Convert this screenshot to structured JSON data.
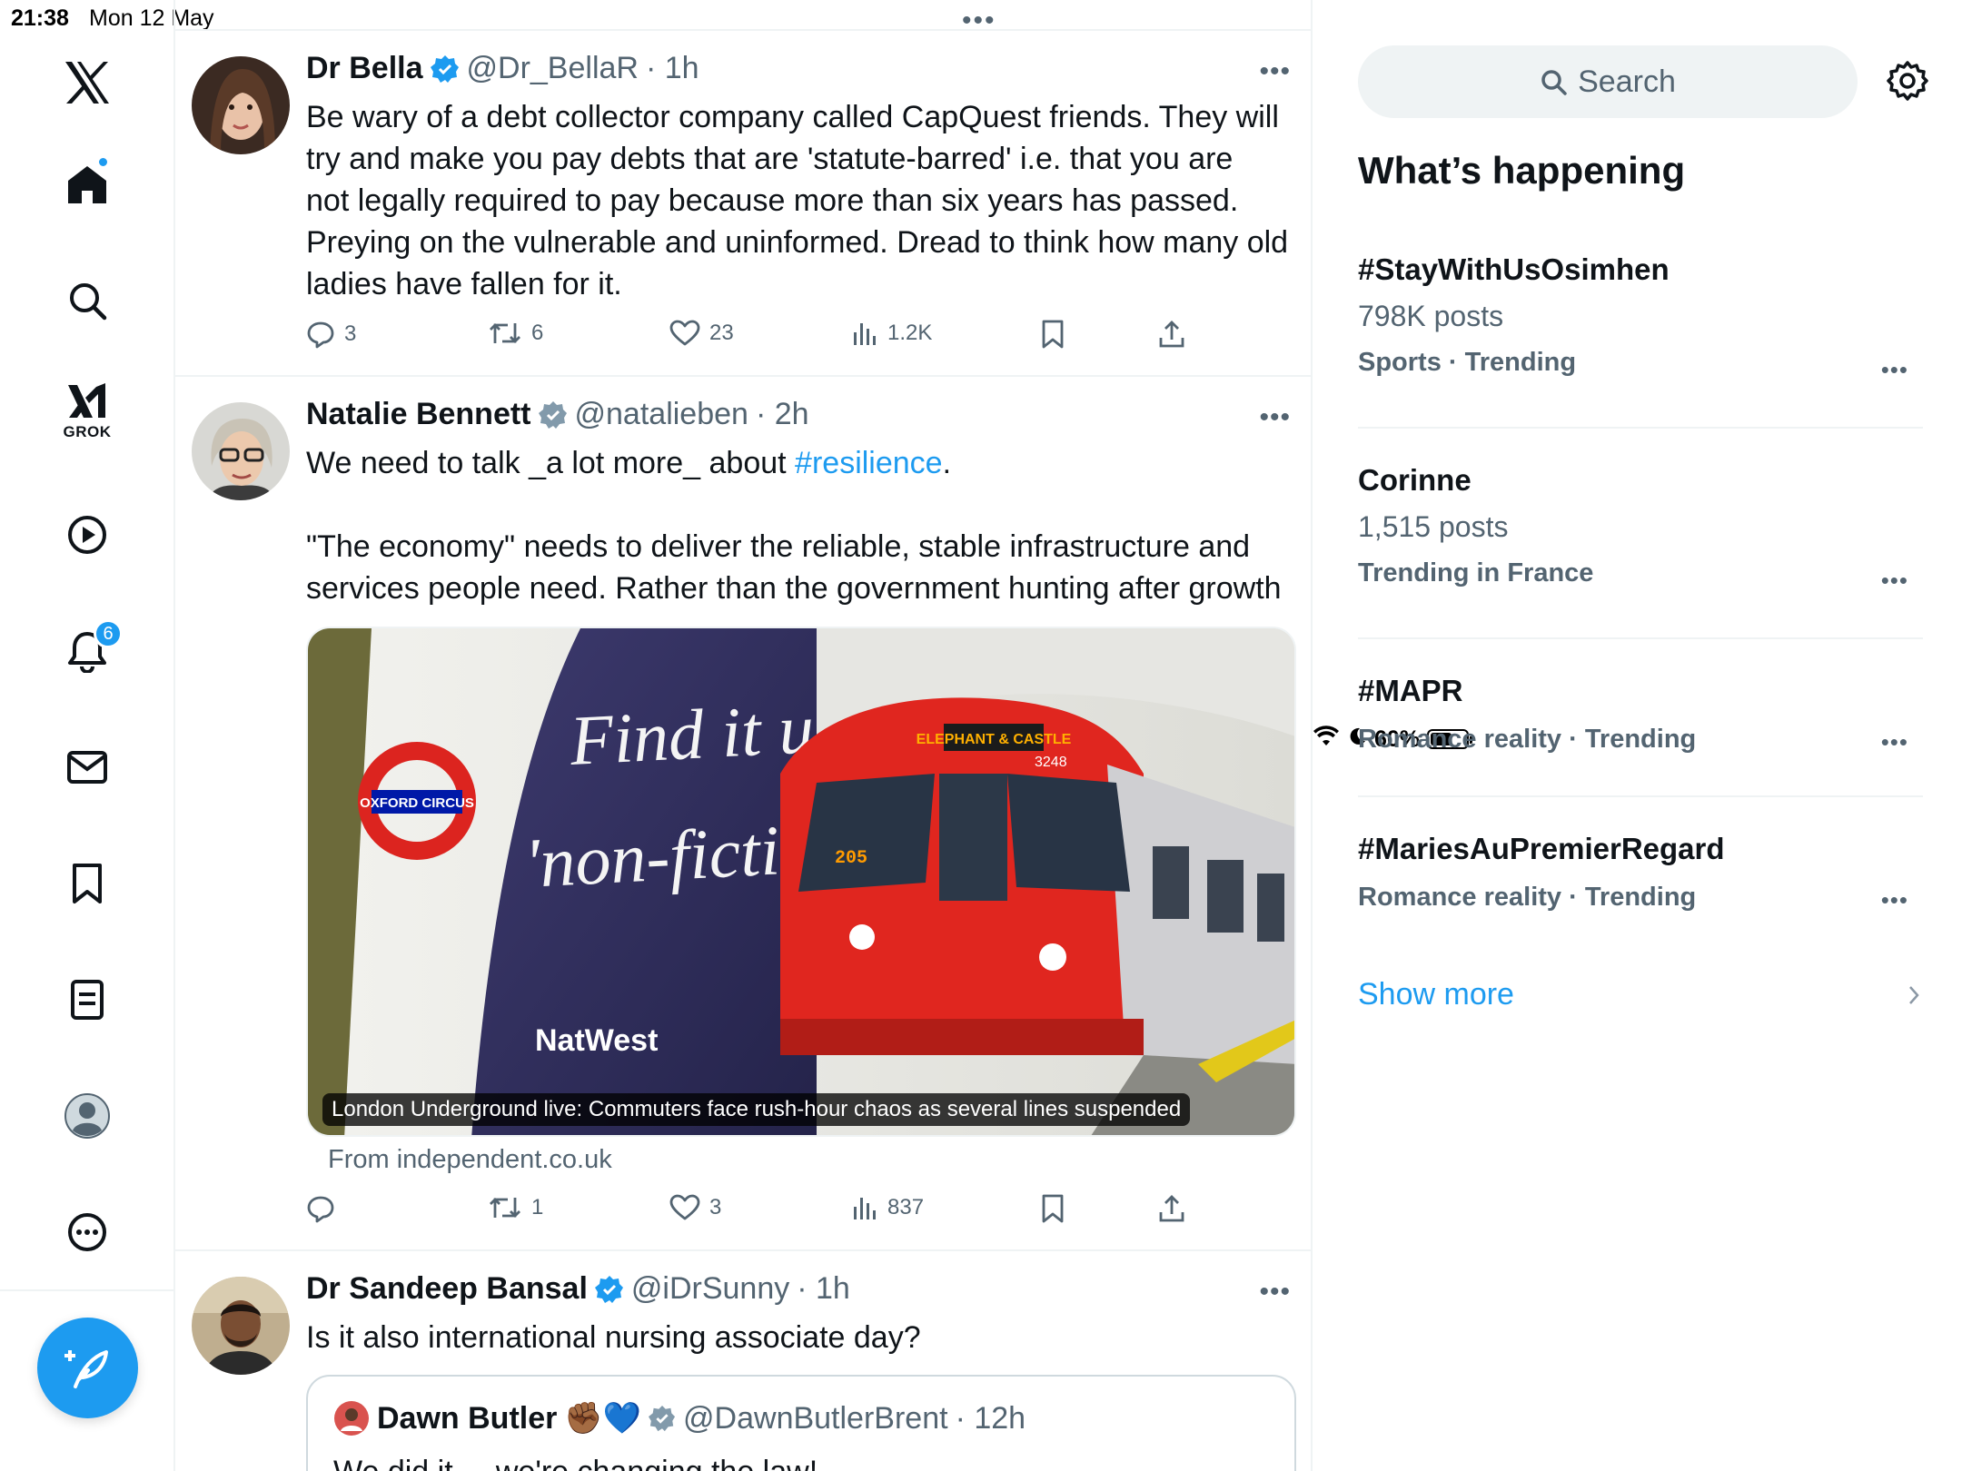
{
  "status_bar": {
    "time": "21:38",
    "date": "Mon 12 May",
    "battery": "60%",
    "battery_level": 0.6
  },
  "nav": {
    "grok_label": "GROK",
    "notifications_badge": "6"
  },
  "tweets": [
    {
      "name": "Dr Bella",
      "handle": "@Dr_BellaR",
      "time": "· 1h",
      "lines": [
        "Be wary of a debt collector company called CapQuest friends. They will",
        "try and make you pay debts that are 'statute-barred' i.e. that you are",
        "not legally required to pay because more than six years has passed.",
        "Preying on the vulnerable and uninformed. Dread to think how many old",
        "ladies have fallen for it."
      ],
      "replies": "3",
      "reposts": "6",
      "likes": "23",
      "views": "1.2K"
    },
    {
      "name": "Natalie Bennett",
      "handle": "@natalieben",
      "time": "· 2h",
      "line1_prefix": "We need to talk _a lot more_ about ",
      "line1_hashtag": "#resilience",
      "line1_suffix": ".",
      "line3": "\"The economy\" needs to deliver the reliable, stable infrastructure and",
      "line4": "services people need. Rather than the government hunting after growth",
      "media": {
        "caption": "London Underground live: Commuters face rush-hour chaos as several lines suspended",
        "source": "From independent.co.uk",
        "billboard_line1": "Find it under",
        "billboard_line2": "'non-fiction'",
        "brand": "NatWest",
        "roundel": "OXFORD CIRCUS",
        "destination": "ELEPHANT & CASTLE",
        "train_number": "3248",
        "route_number": "205"
      },
      "replies": "",
      "reposts": "1",
      "likes": "3",
      "views": "837"
    },
    {
      "name": "Dr Sandeep Bansal",
      "handle": "@iDrSunny",
      "time": "· 1h",
      "text": "Is it also international nursing associate day?",
      "quote": {
        "name": "Dawn Butler",
        "emoji": "✊🏾💙",
        "handle": "@DawnButlerBrent",
        "time": "· 12h",
        "text": "We did it ... we're changing the law!"
      }
    }
  ],
  "sidebar": {
    "search_placeholder": "Search",
    "heading": "What’s happening",
    "trends": [
      {
        "title": "#StayWithUsOsimhen",
        "count": "798K posts",
        "meta": "Sports · Trending"
      },
      {
        "title": "Corinne",
        "count": "1,515 posts",
        "meta": "Trending in France"
      },
      {
        "title": "#MAPR",
        "count": "",
        "meta": "Romance reality · Trending"
      },
      {
        "title": "#MariesAuPremierRegard",
        "count": "",
        "meta": "Romance reality · Trending"
      }
    ],
    "show_more": "Show more"
  },
  "colors": {
    "accent": "#1d9bf0",
    "secondary_text": "#536471",
    "primary_text": "#0f1419",
    "divider": "#eff3f4"
  }
}
